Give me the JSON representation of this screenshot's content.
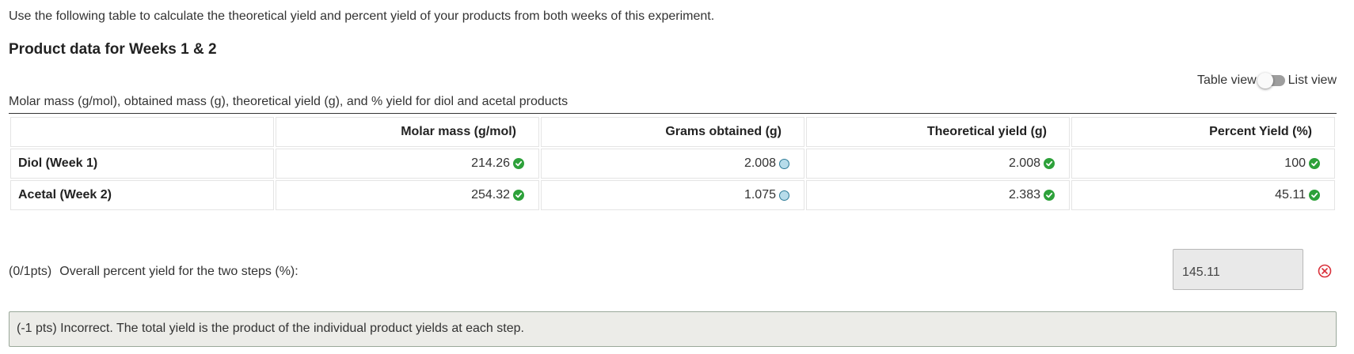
{
  "intro_text": "Use the following table to calculate the theoretical yield and percent yield of your products from both weeks of this experiment.",
  "heading": "Product data for Weeks 1 & 2",
  "view_toggle": {
    "left_label": "Table view",
    "right_label": "List view",
    "state": "table"
  },
  "table": {
    "caption": "Molar mass (g/mol), obtained mass (g), theoretical yield (g), and % yield for diol and acetal products",
    "columns": [
      "",
      "Molar mass (g/mol)",
      "Grams obtained (g)",
      "Theoretical yield (g)",
      "Percent Yield (%)"
    ],
    "rows": [
      {
        "label": "Diol (Week 1)",
        "molar_mass": "214.26",
        "grams_obtained": "2.008",
        "theoretical_yield": "2.008",
        "percent_yield": "100"
      },
      {
        "label": "Acetal (Week 2)",
        "molar_mass": "254.32",
        "grams_obtained": "1.075",
        "theoretical_yield": "2.383",
        "percent_yield": "45.11"
      }
    ],
    "status_icons": {
      "correct": "check-circle-icon",
      "given": "info-circle-icon"
    }
  },
  "question": {
    "points": "(0/1pts)",
    "prompt": "Overall percent yield for the two steps (%):",
    "answer_value": "145.11",
    "status_icon": "x-circle-icon"
  },
  "feedback": {
    "text": "(-1 pts) Incorrect. The total yield is the product of the individual product yields at each step."
  },
  "colors": {
    "correct": "#2da13a",
    "incorrect": "#d9303a",
    "given_fill": "#b7dcea",
    "given_border": "#2c7a96",
    "feedback_bg": "#ecece8"
  }
}
